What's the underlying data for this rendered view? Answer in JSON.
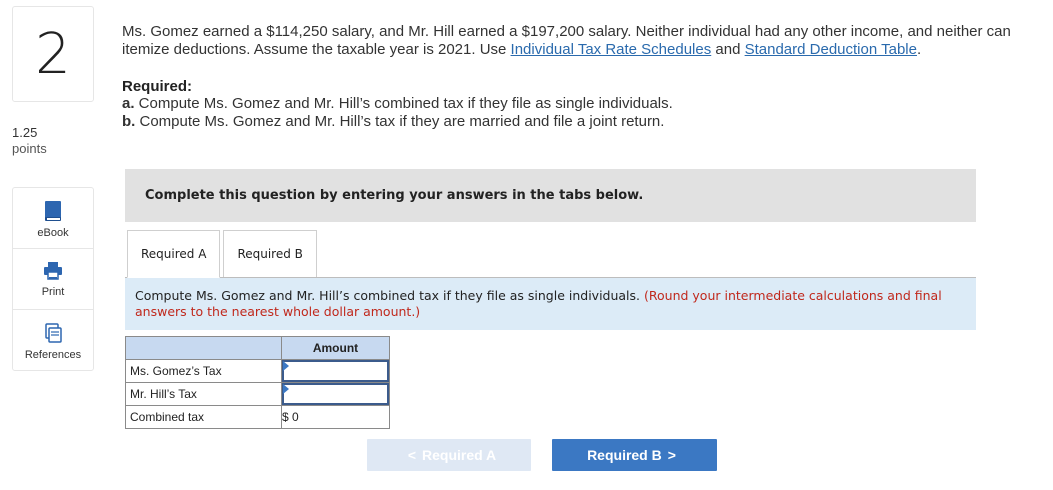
{
  "question": {
    "number": "2",
    "points_value": "1.25",
    "points_label": "points"
  },
  "tools": [
    {
      "label": "eBook",
      "icon": "book-icon"
    },
    {
      "label": "Print",
      "icon": "printer-icon"
    },
    {
      "label": "References",
      "icon": "references-icon"
    }
  ],
  "prompt": {
    "text_before": "Ms. Gomez earned a $114,250 salary, and Mr. Hill earned a $197,200 salary. Neither individual had any other income, and neither can itemize deductions. Assume the taxable year is 2021. Use ",
    "link1": "Individual Tax Rate Schedules",
    "and": " and ",
    "link2": "Standard Deduction Table",
    "period": "."
  },
  "required": {
    "heading": "Required:",
    "a_prefix": "a.",
    "a_text": " Compute Ms. Gomez and Mr. Hill’s combined tax if they file as single individuals.",
    "b_prefix": "b.",
    "b_text": " Compute Ms. Gomez and Mr. Hill’s tax if they are married and file a joint return."
  },
  "banner": "Complete this question by entering your answers in the tabs below.",
  "tabs": [
    {
      "label": "Required A",
      "active": true
    },
    {
      "label": "Required B",
      "active": false
    }
  ],
  "instruction": {
    "text": "Compute Ms. Gomez and Mr. Hill’s combined tax if they file as single individuals. ",
    "note": "(Round your intermediate calculations and final answers to the nearest whole dollar amount.)"
  },
  "table": {
    "header_amount": "Amount",
    "rows": [
      {
        "label": "Ms. Gomez’s Tax",
        "value": ""
      },
      {
        "label": "Mr. Hill’s Tax",
        "value": ""
      },
      {
        "label": "Combined tax",
        "currency": "$",
        "value": "0"
      }
    ]
  },
  "nav": {
    "prev_label": "Required A",
    "next_label": "Required B",
    "prev_chevron": "<",
    "next_chevron": ">"
  },
  "colors": {
    "accent": "#3b78c3",
    "disabled": "#dfe8f4",
    "note_red": "#c0281c",
    "instruction_bg": "#dcebf7",
    "banner_bg": "#e1e1e1",
    "table_header_bg": "#c7d9f0"
  }
}
